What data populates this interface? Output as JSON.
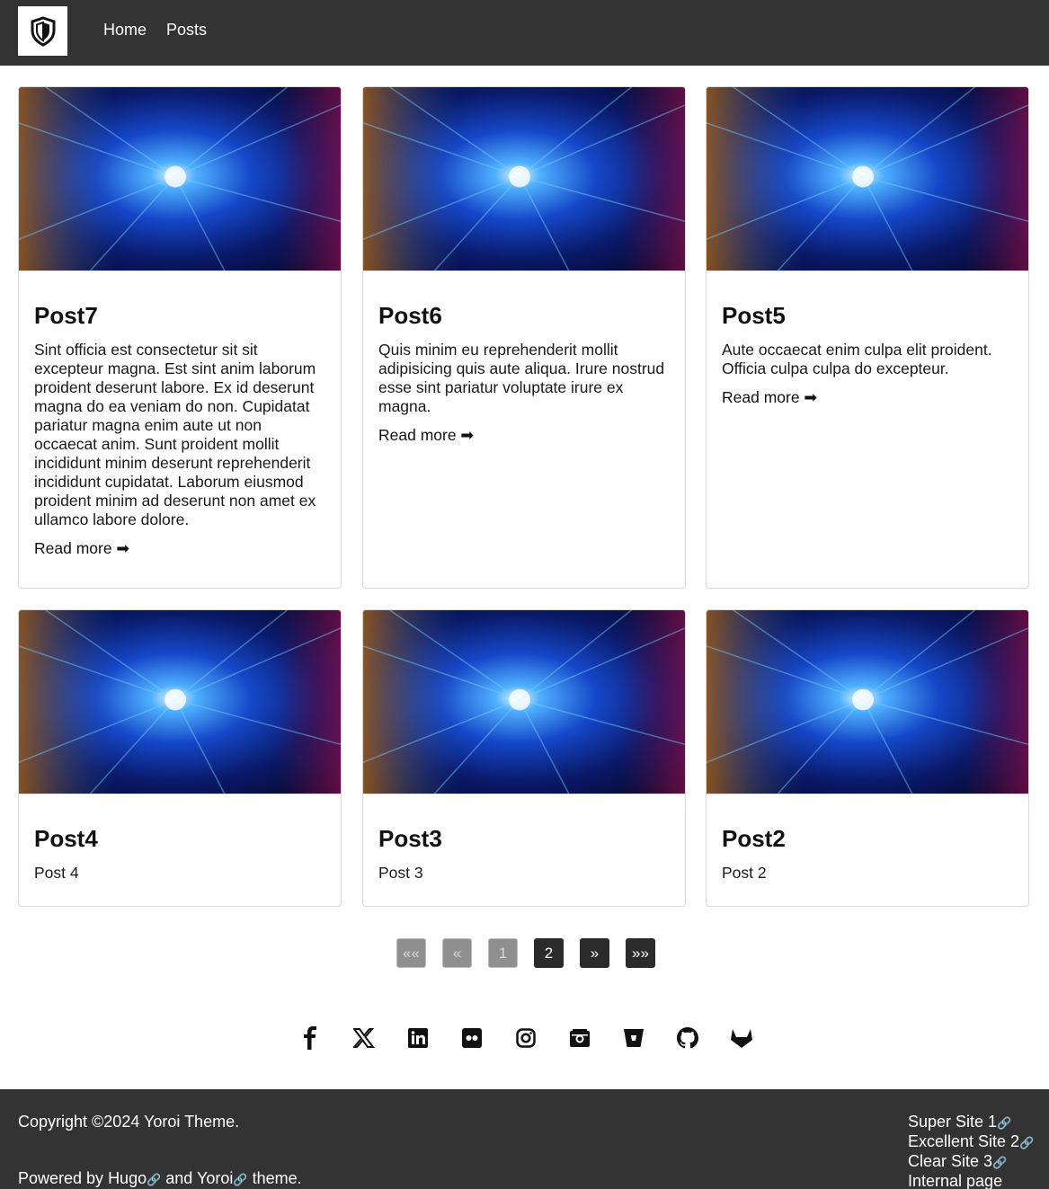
{
  "header": {
    "logo_icon": "shield-icon",
    "nav": [
      {
        "label": "Home"
      },
      {
        "label": "Posts"
      }
    ]
  },
  "posts": [
    {
      "title": "Post7",
      "summary": "Sint officia est consectetur sit sit excepteur magna. Est sint anim laborum proident deserunt labore. Ex id deserunt magna do ea veniam do non. Cupidatat pariatur magna enim aute ut non occaecat anim. Sunt proident mollit incididunt minim deserunt reprehenderit incididunt cupidatat. Laborum eiusmod proident minim ad deserunt non amet ex ullamco labore dolore.",
      "read_more": "Read more ➡"
    },
    {
      "title": "Post6",
      "summary": "Quis minim eu reprehenderit mollit adipisicing quis aute aliqua. Irure nostrud esse sint pariatur voluptate irure ex magna.",
      "read_more": "Read more ➡"
    },
    {
      "title": "Post5",
      "summary": "Aute occaecat enim culpa elit proident. Officia culpa culpa do excepteur.",
      "read_more": "Read more ➡"
    },
    {
      "title": "Post4",
      "summary": "Post 4"
    },
    {
      "title": "Post3",
      "summary": "Post 3"
    },
    {
      "title": "Post2",
      "summary": "Post 2"
    }
  ],
  "pagination": [
    {
      "label": "««",
      "state": "disabled"
    },
    {
      "label": "«",
      "state": "disabled"
    },
    {
      "label": "1",
      "state": "disabled"
    },
    {
      "label": "2",
      "state": "active"
    },
    {
      "label": "»",
      "state": "active"
    },
    {
      "label": "»»",
      "state": "active"
    }
  ],
  "social": [
    "facebook-icon",
    "x-icon",
    "linkedin-icon",
    "flickr-icon",
    "instagram-icon",
    "camera-icon",
    "bitbucket-icon",
    "github-icon",
    "gitlab-icon"
  ],
  "footer": {
    "copyright": "Copyright ©2024 Yoroi Theme.",
    "powered_prefix": "Powered by ",
    "powered_hugo": "Hugo",
    "powered_and": " and ",
    "powered_yoroi": "Yoroi",
    "powered_suffix": " theme.",
    "links": [
      {
        "label": "Super Site 1",
        "external": true
      },
      {
        "label": "Excellent Site 2",
        "external": true
      },
      {
        "label": "Clear Site 3",
        "external": true
      },
      {
        "label": "Internal page",
        "external": false
      }
    ],
    "link_glyph": "🔗"
  },
  "colors": {
    "header_bg": "#333333",
    "footer_bg": "#333333",
    "pager_active": "#2b2b2b",
    "pager_disabled": "#8f8f8f"
  }
}
